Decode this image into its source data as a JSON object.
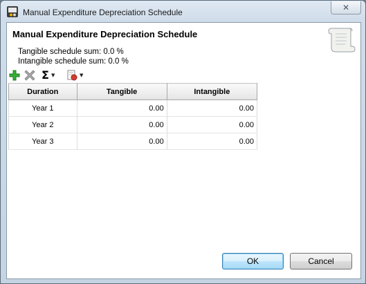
{
  "window": {
    "title": "Manual Expenditure Depreciation Schedule",
    "close_glyph": "✕",
    "app_icon": "computer-app-icon"
  },
  "header": {
    "title": "Manual Expenditure Depreciation Schedule",
    "tangible_sum": "Tangible schedule sum: 0.0 %",
    "intangible_sum": "Intangible schedule sum: 0.0 %",
    "icon": "scroll-icon"
  },
  "toolbar": {
    "items": [
      {
        "name": "add-icon",
        "color": "#2ea82e"
      },
      {
        "name": "delete-icon",
        "color": "#9a9a9a"
      },
      {
        "name": "sum-icon",
        "glyph": "Σ"
      },
      {
        "name": "report-icon",
        "color": "#c0392b"
      }
    ],
    "dropdown_glyph": "▼"
  },
  "table": {
    "columns": [
      "Duration",
      "Tangible",
      "Intangible"
    ],
    "rows": [
      [
        "Year 1",
        "0.00",
        "0.00"
      ],
      [
        "Year 2",
        "0.00",
        "0.00"
      ],
      [
        "Year 3",
        "0.00",
        "0.00"
      ]
    ]
  },
  "buttons": {
    "ok": "OK",
    "cancel": "Cancel"
  }
}
